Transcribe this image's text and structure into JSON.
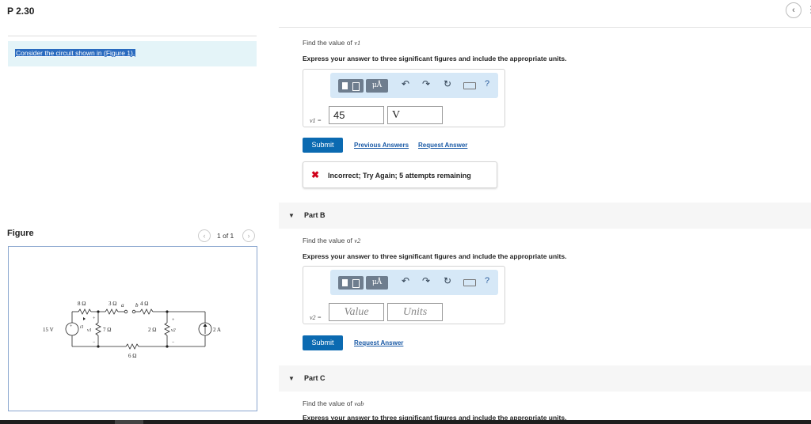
{
  "header": {
    "title": "P 2.30",
    "back_icon": "‹",
    "more_icon": "⋮"
  },
  "intro": {
    "text": "Consider the circuit shown in (Figure 1)."
  },
  "figure": {
    "label": "Figure",
    "prev": "‹",
    "count": "1 of 1",
    "next": "›",
    "circuit": {
      "source_voltage": "15 V",
      "r1": "8 Ω",
      "r2": "3 Ω",
      "node_a": "a",
      "node_b": "b",
      "r3": "4 Ω",
      "r4": "7 Ω",
      "r5": "2 Ω",
      "r6": "6 Ω",
      "current_source": "2 A",
      "v1": "v1",
      "v2": "v2",
      "i1": "i1",
      "plus": "+",
      "minus": "−"
    }
  },
  "part_a": {
    "prompt_prefix": "Find the value of",
    "prompt_var": "v1",
    "instruction": "Express your answer to three significant figures and include the appropriate units.",
    "toolbar": {
      "units_label": "μÅ",
      "undo": "↶",
      "redo": "↷",
      "reset": "↻",
      "help": "?"
    },
    "var_label": "v1 =",
    "value": "45",
    "units": "V",
    "submit_label": "Submit",
    "previous_answers_label": "Previous Answers",
    "request_answer_label": "Request Answer",
    "feedback_icon": "✖",
    "feedback_text": "Incorrect; Try Again; 5 attempts remaining"
  },
  "part_b": {
    "header": "Part B",
    "arrow": "▼",
    "prompt_prefix": "Find the value of",
    "prompt_var": "v2",
    "instruction": "Express your answer to three significant figures and include the appropriate units.",
    "toolbar": {
      "units_label": "μÅ",
      "undo": "↶",
      "redo": "↷",
      "reset": "↻",
      "help": "?"
    },
    "var_label": "v2 =",
    "value_placeholder": "Value",
    "units_placeholder": "Units",
    "submit_label": "Submit",
    "request_answer_label": "Request Answer"
  },
  "part_c": {
    "header": "Part C",
    "arrow": "▼",
    "prompt_prefix": "Find the value of",
    "prompt_var": "vab",
    "instruction": "Express your answer to three significant figures and include the appropriate units."
  },
  "colors": {
    "accent": "#0b6ab1",
    "toolbar_bg": "#d6e8f7",
    "intro_bg": "#e4f4f8",
    "error": "#d0021b"
  }
}
